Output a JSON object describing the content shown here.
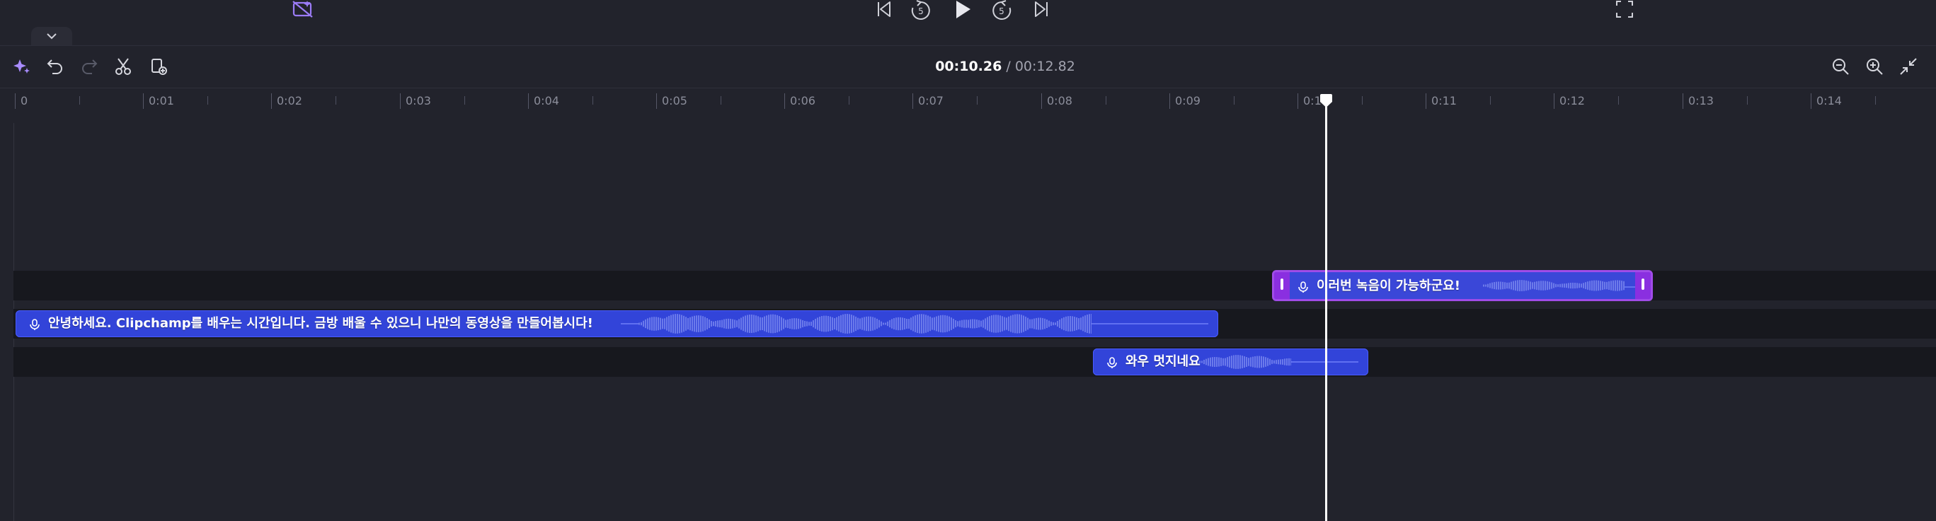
{
  "player": {
    "icons": [
      "captions-off-icon",
      "skip-back-icon",
      "rewind-5-icon",
      "play-icon",
      "forward-5-icon",
      "skip-forward-icon",
      "fullscreen-icon"
    ],
    "rewind_seconds": "5",
    "forward_seconds": "5"
  },
  "toolbar": {
    "icons": [
      "magic-icon",
      "undo-icon",
      "redo-icon",
      "split-icon",
      "add-media-icon"
    ],
    "zoom_icons": [
      "zoom-out-icon",
      "zoom-in-icon",
      "fit-to-screen-icon"
    ],
    "time_current": "00:10.26",
    "time_separator": " / ",
    "time_total": "00:12.82"
  },
  "ruler": {
    "labels": [
      "0",
      "0:01",
      "0:02",
      "0:03",
      "0:04",
      "0:05",
      "0:06",
      "0:07",
      "0:08",
      "0:09",
      "0:10",
      "0:11",
      "0:12",
      "0:13",
      "0:14"
    ]
  },
  "clips": [
    {
      "track": 1,
      "text": "이러번 녹음이 가능하군요!",
      "selected": true
    },
    {
      "track": 2,
      "text": "안녕하세요. Clipchamp를 배우는 시간입니다. 금방 배울 수 있으니 나만의 동영상을 만들어봅시다!",
      "selected": false
    },
    {
      "track": 3,
      "text": "와우 멋지네요",
      "selected": false
    }
  ],
  "playhead": {
    "time": "00:10.26"
  },
  "colors": {
    "background": "#22232c",
    "track": "#17181e",
    "clip": "#3244d9",
    "selection": "#8a2fe0",
    "playhead": "#ffffff",
    "accent_icon": "#a98cff"
  }
}
